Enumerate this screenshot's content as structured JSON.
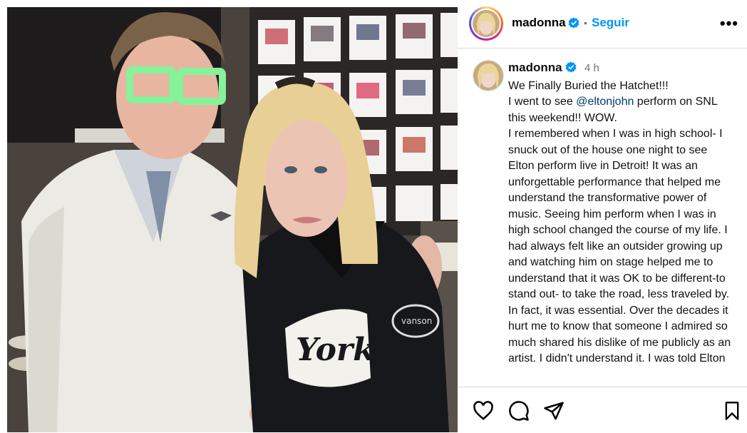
{
  "photo": {
    "description_icon": "photo-of-two-people"
  },
  "header": {
    "username": "madonna",
    "separator": "•",
    "follow_label": "Seguir",
    "more_icon": "more-options-icon",
    "more_label": "•••"
  },
  "caption": {
    "username": "madonna",
    "time": "4 h",
    "line1": "We Finally Buried the Hatchet!!!",
    "line2_pre": "I went to see ",
    "mention": "@eltonjohn",
    "line2_post": " perform on SNL this weekend!! WOW.",
    "body": "I remembered when I was in high school- I snuck out of the house one night to see Elton perform live in Detroit! It was an unforgettable performance that helped me understand the transformative power of music. Seeing him perform when I was in high school changed the course of my life. I had always felt like an outsider growing up and watching him on stage helped me to understand that it was OK to be different-to stand out- to take the road, less traveled by. In fact, it was essential. Over the decades it hurt me to know that someone I admired so much shared his dislike of me publicly as an artist. I didn't understand it. I was told Elton"
  },
  "actions": {
    "like_icon": "heart-icon",
    "comment_icon": "comment-icon",
    "share_icon": "share-icon",
    "save_icon": "bookmark-icon"
  },
  "colors": {
    "follow": "#0095f6",
    "verified": "#0095f6",
    "mention": "#00376b"
  }
}
